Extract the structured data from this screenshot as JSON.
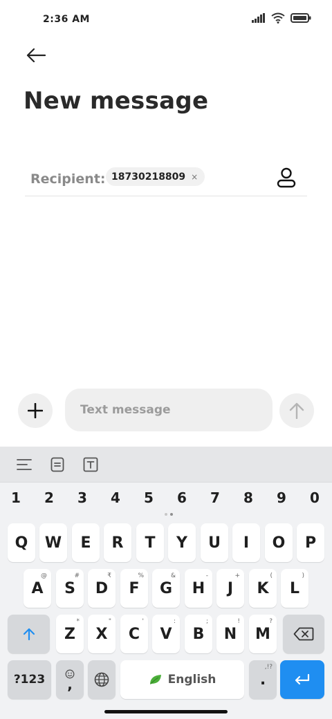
{
  "status_bar": {
    "time": "2:36 AM"
  },
  "header": {
    "title": "New message"
  },
  "recipient": {
    "label": "Recipient:",
    "chip_number": "18730218809",
    "chip_close": "×"
  },
  "compose": {
    "placeholder": "Text message"
  },
  "keyboard": {
    "numbers": [
      "1",
      "2",
      "3",
      "4",
      "5",
      "6",
      "7",
      "8",
      "9",
      "0"
    ],
    "row1": [
      "Q",
      "W",
      "E",
      "R",
      "T",
      "Y",
      "U",
      "I",
      "O",
      "P"
    ],
    "row2": [
      {
        "key": "A",
        "hint": "@"
      },
      {
        "key": "S",
        "hint": "#"
      },
      {
        "key": "D",
        "hint": "₹"
      },
      {
        "key": "F",
        "hint": "%"
      },
      {
        "key": "G",
        "hint": "&"
      },
      {
        "key": "H",
        "hint": "-"
      },
      {
        "key": "J",
        "hint": "+"
      },
      {
        "key": "K",
        "hint": "("
      },
      {
        "key": "L",
        "hint": ")"
      }
    ],
    "row3": [
      {
        "key": "Z",
        "hint": "*"
      },
      {
        "key": "X",
        "hint": "\""
      },
      {
        "key": "C",
        "hint": "'"
      },
      {
        "key": "V",
        "hint": ":"
      },
      {
        "key": "B",
        "hint": ";"
      },
      {
        "key": "N",
        "hint": "!"
      },
      {
        "key": "M",
        "hint": "?"
      }
    ],
    "symbols_label": "?123",
    "comma_label": ",",
    "space_label": "English",
    "period_label": ".",
    "period_hint": ",!?"
  },
  "colors": {
    "accent": "#1f8ef1",
    "leaf": "#4caf3a"
  }
}
